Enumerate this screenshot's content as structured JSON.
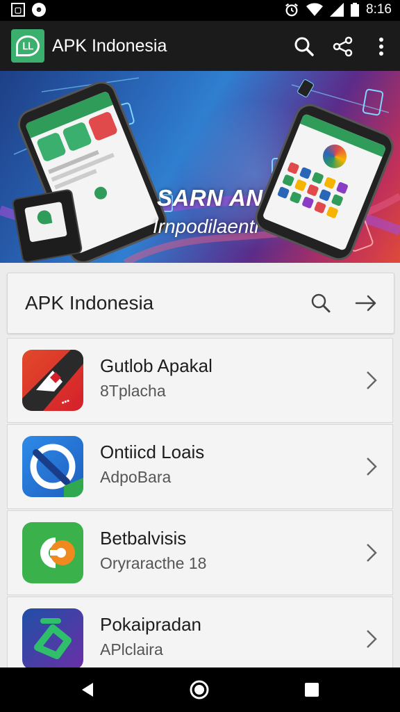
{
  "status_bar": {
    "time": "8:16",
    "left_icons": [
      "box-icon",
      "cat-icon"
    ],
    "right_icons": [
      "alarm-icon",
      "wifi-icon",
      "signal-icon",
      "battery-icon"
    ]
  },
  "app_bar": {
    "title": "APK Indonesia",
    "actions": [
      "search-icon",
      "share-icon",
      "more-vert-icon"
    ],
    "accent": "#3aaf6e"
  },
  "hero": {
    "headline": "SARN ANDGN",
    "subheadline": "Irnpodilaenti"
  },
  "search_card": {
    "title": "APK Indonesia"
  },
  "apps": [
    {
      "name": "Gutlob Apakal",
      "subtitle": "8Tplacha",
      "icon": "red-arrow-app-icon"
    },
    {
      "name": "Ontiicd Loais",
      "subtitle": "AdpoBara",
      "icon": "blue-sync-app-icon"
    },
    {
      "name": "Betbalvisis",
      "subtitle": "Oryraracthe 18",
      "icon": "green-cp-app-icon"
    },
    {
      "name": "Pokaipradan",
      "subtitle": "APlclaira",
      "icon": "green-arrow-app-icon"
    }
  ],
  "nav_bar": [
    "back-icon",
    "home-icon",
    "recents-icon"
  ]
}
